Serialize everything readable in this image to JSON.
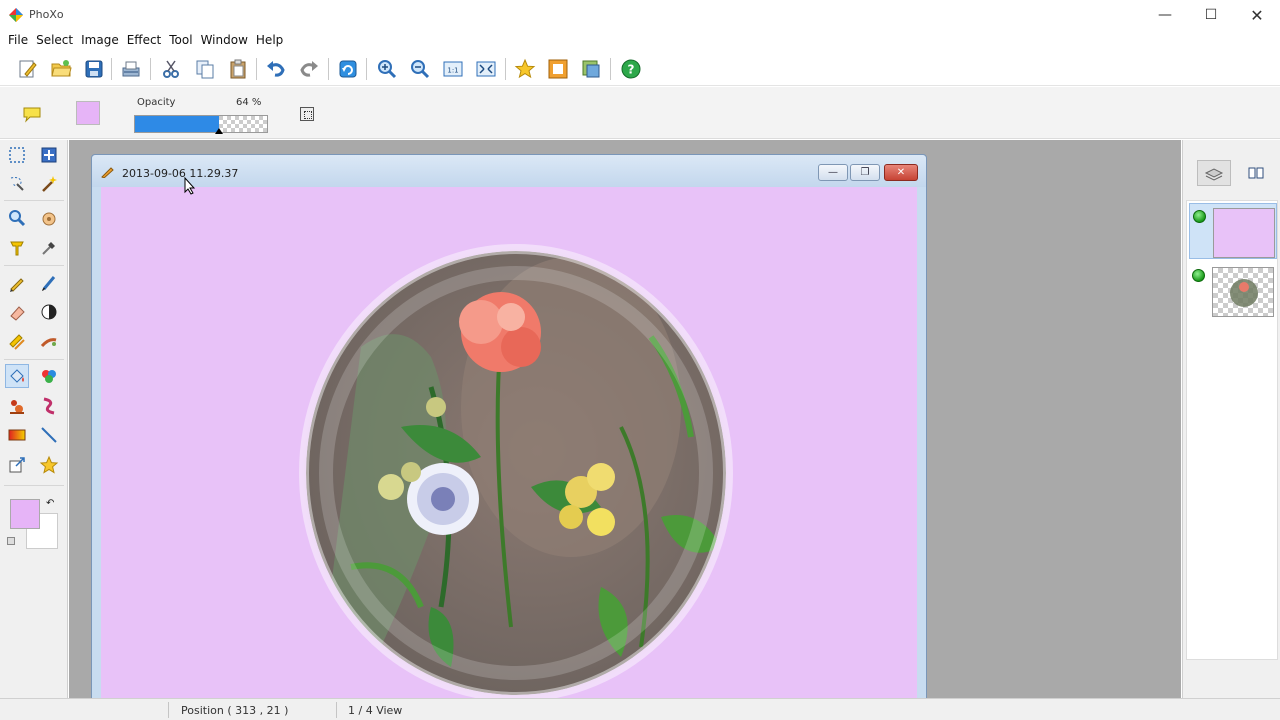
{
  "app": {
    "title": "PhoXo",
    "controls": {
      "minimize": "—",
      "maximize": "☐",
      "close": "✕"
    }
  },
  "menu": [
    "File",
    "Select",
    "Image",
    "Effect",
    "Tool",
    "Window",
    "Help"
  ],
  "toolbar": {
    "buttons": [
      "new-icon",
      "open-folder-icon",
      "save-icon",
      "scan-icon",
      "cut-icon",
      "copy-icon",
      "paste-icon",
      "undo-icon",
      "redo-icon",
      "rotate-icon",
      "zoom-in-icon",
      "zoom-out-icon",
      "actual-size-icon",
      "fit-window-icon",
      "favorite-star-icon",
      "frame-icon",
      "batch-icon",
      "help-icon"
    ]
  },
  "options": {
    "opacity_label": "Opacity",
    "opacity_value": "64 %",
    "opacity_fraction": 0.64,
    "color": "#e6b4f7"
  },
  "document": {
    "title": "2013-09-06 11.29.37",
    "canvas_color": "#e8c2f8",
    "controls": {
      "minimize": "—",
      "restore": "❐",
      "close": "✕"
    }
  },
  "layers": [
    {
      "name": "layer-background",
      "visible": true,
      "selected": true
    },
    {
      "name": "layer-flower",
      "visible": true,
      "selected": false
    }
  ],
  "status": {
    "position": "Position ( 313 , 21 )",
    "view": "1 / 4 View"
  },
  "colors": {
    "accent": "#2e8ae6",
    "foreground": "#e6b4f7",
    "background": "#ffffff"
  }
}
